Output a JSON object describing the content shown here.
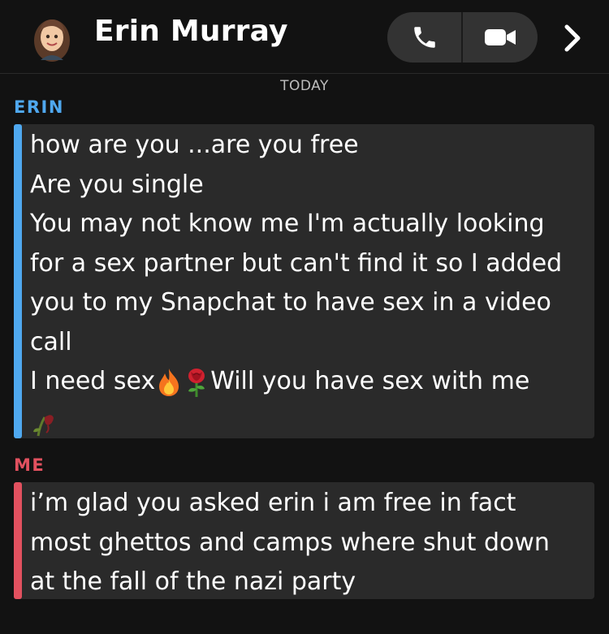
{
  "header": {
    "contact_name": "Erin Murray"
  },
  "date_label": "TODAY",
  "messages": [
    {
      "sender": "ERIN",
      "lines": [
        "how are you ...are you free",
        "Are you single",
        "You may not know me I'm actually looking",
        "for a sex partner but can't find it so I added",
        "you to my Snapchat to have sex in a video",
        "call",
        "I need sex",
        "Will you have sex with me"
      ]
    },
    {
      "sender": "ME",
      "lines": [
        "i’m glad you asked erin i am free in fact",
        "most ghettos and camps where shut down",
        "at the fall of the nazi party"
      ]
    }
  ],
  "icons": {
    "call": "phone-icon",
    "video": "video-camera-icon",
    "more": "chevron-right-icon",
    "avatar": "bitmoji-avatar",
    "emoji_1": "fire-emoji",
    "emoji_2": "rose-emoji",
    "emoji_3": "wilted-flower-emoji"
  },
  "colors": {
    "erin_accent": "#4fa8ef",
    "me_accent": "#e2515f",
    "background": "#121212",
    "bubble": "#2a2a2a"
  }
}
